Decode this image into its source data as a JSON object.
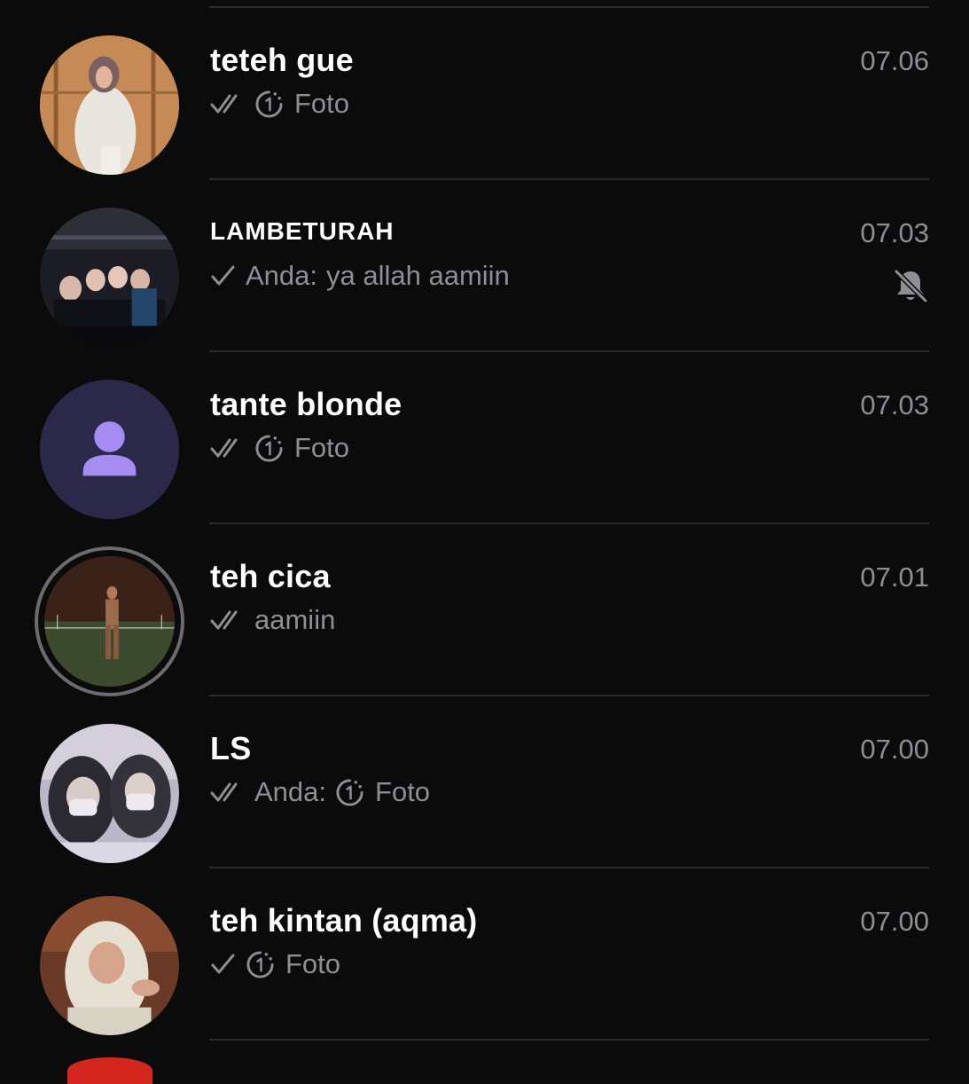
{
  "chats": [
    {
      "name": "teteh gue",
      "time": "07.06",
      "receipt": "double-check-icon",
      "preview_sender": "",
      "view_once_icon": "view-once-icon",
      "preview_text": "Foto",
      "muted": false,
      "avatar": "photo"
    },
    {
      "name": "LAMBETURAH",
      "time": "07.03",
      "receipt": "single-check-icon",
      "preview_sender": "Anda:",
      "view_once_icon": "",
      "preview_text": "ya allah aamiin",
      "muted": true,
      "muted_icon": "muted-bell-icon",
      "avatar": "photo"
    },
    {
      "name": "tante blonde",
      "time": "07.03",
      "receipt": "double-check-icon",
      "preview_sender": "",
      "view_once_icon": "view-once-icon",
      "preview_text": "Foto",
      "muted": false,
      "avatar": "default-person-icon",
      "avatar_colors": {
        "background": "#2b2849",
        "icon": "#a48cf2"
      }
    },
    {
      "name": "teh cica",
      "time": "07.01",
      "receipt": "double-check-icon",
      "preview_sender": "",
      "view_once_icon": "",
      "preview_text": "aamiin",
      "muted": false,
      "avatar": "photo",
      "status_ring": true
    },
    {
      "name": "LS",
      "time": "07.00",
      "receipt": "double-check-icon",
      "preview_sender": "Anda:",
      "view_once_icon": "view-once-icon",
      "preview_text": "Foto",
      "muted": false,
      "avatar": "photo"
    },
    {
      "name": "teh kintan (aqma)",
      "time": "07.00",
      "receipt": "single-check-icon",
      "preview_sender": "",
      "view_once_icon": "view-once-icon",
      "preview_text": "Foto",
      "muted": false,
      "avatar": "photo"
    }
  ],
  "colors": {
    "background": "#0b0b0c",
    "divider": "#2a2a2c",
    "name": "#ffffff",
    "secondary_text": "#8e8e93"
  }
}
